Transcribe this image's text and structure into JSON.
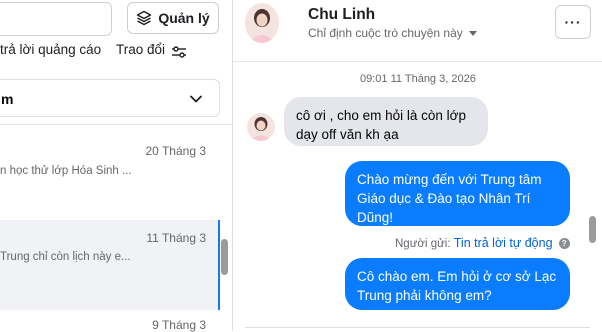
{
  "left_panel": {
    "manage_label": "Quản lý",
    "filters": [
      "trả lời quảng cáo",
      "Trao đổi"
    ],
    "select_value": "m",
    "conversations": [
      {
        "date": "20 Tháng 3",
        "snippet": "n học thử lớp Hóa Sinh ...",
        "selected": false
      },
      {
        "date": "11 Tháng 3",
        "snippet": "Trung chỉ còn lịch này e...",
        "selected": true
      },
      {
        "date": "9 Tháng 3",
        "snippet": "",
        "selected": false
      }
    ]
  },
  "chat": {
    "contact_name": "Chu Linh",
    "assign_label": "Chỉ định cuộc trò chuyện này",
    "more_label": "···",
    "timestamp": "09:01 11 Tháng 3, 2026",
    "incoming": "cô ơi , cho em hỏi là còn lớp dạy off văn kh ạa",
    "outgoing_1": "Chào mừng đến với Trung tâm Giáo dục & Đào tạo Nhân Trí Dũng!",
    "sender_prefix": "Người gửi:",
    "sender_link": "Tin trả lời tự động",
    "outgoing_2": "Cô chào em. Em hỏi ở cơ sở Lạc Trung phải không em?"
  },
  "colors": {
    "outgoing_bubble": "#0a7cff",
    "incoming_bubble": "#e4e6eb",
    "selected_row": "#f0f2f5",
    "accent": "#1877f2"
  },
  "icons": [
    "layers-icon",
    "sliders-icon",
    "chevron-down-icon",
    "help-icon",
    "more-icon"
  ]
}
